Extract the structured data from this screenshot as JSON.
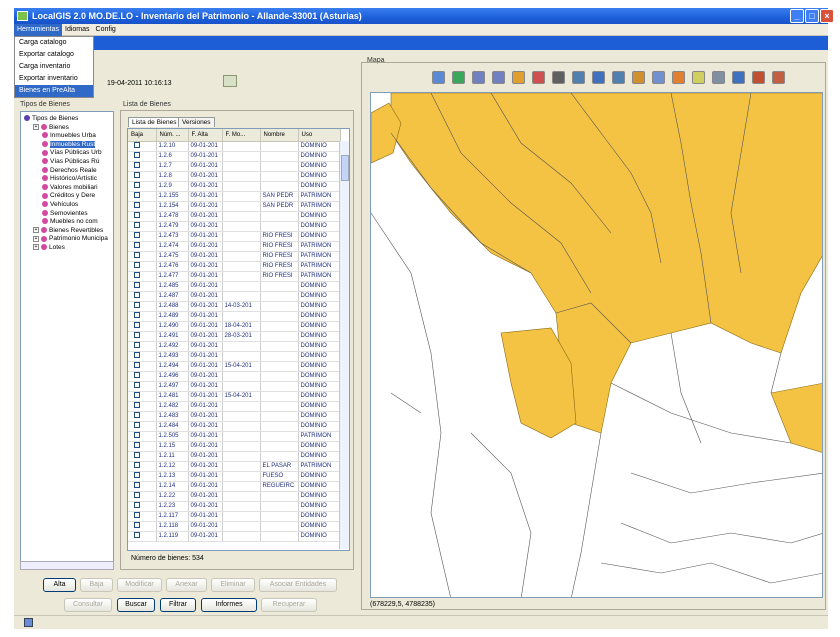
{
  "window": {
    "title": "LocalGIS 2.0 MO.DE.LO - Inventario del Patrimonio - Allande-33001 (Asturias)"
  },
  "menu": {
    "items": [
      "Herramientas",
      "Idiomas",
      "Config"
    ]
  },
  "dropdown": {
    "items": [
      "Carga catalogo",
      "Exportar catalogo",
      "Carga inventario",
      "Exportar inventario",
      "Bienes en PreAlta"
    ],
    "selected_index": 4
  },
  "header": {
    "datetime": "19-04-2011 10:16:13"
  },
  "tree": {
    "title": "Tipos de Bienes",
    "items": [
      {
        "label": "Tipos de Bienes",
        "level": 0,
        "kind": "root"
      },
      {
        "label": "Bienes",
        "level": 1,
        "kind": "group"
      },
      {
        "label": "Inmuebles Urba",
        "level": 2,
        "kind": "leaf"
      },
      {
        "label": "Inmuebles Rust",
        "level": 2,
        "kind": "leaf",
        "selected": true
      },
      {
        "label": "Vías Públicas Urb",
        "level": 2,
        "kind": "leaf"
      },
      {
        "label": "Vías Públicas Rú",
        "level": 2,
        "kind": "leaf"
      },
      {
        "label": "Derechos Reale",
        "level": 2,
        "kind": "leaf"
      },
      {
        "label": "Histórico/Artístic",
        "level": 2,
        "kind": "leaf"
      },
      {
        "label": "Valores mobiliari",
        "level": 2,
        "kind": "leaf"
      },
      {
        "label": "Créditos y Dere",
        "level": 2,
        "kind": "leaf"
      },
      {
        "label": "Vehículos",
        "level": 2,
        "kind": "leaf"
      },
      {
        "label": "Semovientes",
        "level": 2,
        "kind": "leaf"
      },
      {
        "label": "Muebles no com",
        "level": 2,
        "kind": "leaf"
      },
      {
        "label": "Bienes Revertibles",
        "level": 1,
        "kind": "group"
      },
      {
        "label": "Patrimonio Municipa",
        "level": 1,
        "kind": "group"
      },
      {
        "label": "Lotes",
        "level": 1,
        "kind": "group"
      }
    ]
  },
  "list": {
    "title": "Lista de Bienes",
    "tabs": [
      "Lista de Bienes",
      "Versiones"
    ],
    "columns": [
      "Baja",
      "Núm. ...",
      "F. Alta",
      "F. Mo...",
      "Nombre",
      "Uso"
    ],
    "rows": [
      [
        "1.2.10",
        "09-01-201",
        "",
        "",
        "DOMINIO"
      ],
      [
        "1.2.6",
        "09-01-201",
        "",
        "",
        "DOMINIO"
      ],
      [
        "1.2.7",
        "09-01-201",
        "",
        "",
        "DOMINIO"
      ],
      [
        "1.2.8",
        "09-01-201",
        "",
        "",
        "DOMINIO"
      ],
      [
        "1.2.9",
        "09-01-201",
        "",
        "",
        "DOMINIO"
      ],
      [
        "1.2.155",
        "09-01-201",
        "",
        "SAN PEDR",
        "PATRIMON"
      ],
      [
        "1.2.154",
        "09-01-201",
        "",
        "SAN PEDR",
        "PATRIMON"
      ],
      [
        "1.2.478",
        "09-01-201",
        "",
        "",
        "DOMINIO"
      ],
      [
        "1.2.479",
        "09-01-201",
        "",
        "",
        "DOMINIO"
      ],
      [
        "1.2.473",
        "09-01-201",
        "",
        "RIO FRESI",
        "DOMINIO"
      ],
      [
        "1.2.474",
        "09-01-201",
        "",
        "RIO FRESI",
        "PATRIMON"
      ],
      [
        "1.2.475",
        "09-01-201",
        "",
        "RIO FRESI",
        "PATRIMON"
      ],
      [
        "1.2.476",
        "09-01-201",
        "",
        "RIO FRESI",
        "PATRIMON"
      ],
      [
        "1.2.477",
        "09-01-201",
        "",
        "RIO FRESI",
        "PATRIMON"
      ],
      [
        "1.2.485",
        "09-01-201",
        "",
        "",
        "DOMINIO"
      ],
      [
        "1.2.487",
        "09-01-201",
        "",
        "",
        "DOMINIO"
      ],
      [
        "1.2.488",
        "09-01-201",
        "14-03-201",
        "",
        "DOMINIO"
      ],
      [
        "1.2.489",
        "09-01-201",
        "",
        "",
        "DOMINIO"
      ],
      [
        "1.2.490",
        "09-01-201",
        "18-04-201",
        "",
        "DOMINIO"
      ],
      [
        "1.2.491",
        "09-01-201",
        "28-03-201",
        "",
        "DOMINIO"
      ],
      [
        "1.2.492",
        "09-01-201",
        "",
        "",
        "DOMINIO"
      ],
      [
        "1.2.493",
        "09-01-201",
        "",
        "",
        "DOMINIO"
      ],
      [
        "1.2.494",
        "09-01-201",
        "15-04-201",
        "",
        "DOMINIO"
      ],
      [
        "1.2.496",
        "09-01-201",
        "",
        "",
        "DOMINIO"
      ],
      [
        "1.2.497",
        "09-01-201",
        "",
        "",
        "DOMINIO"
      ],
      [
        "1.2.481",
        "09-01-201",
        "15-04-201",
        "",
        "DOMINIO"
      ],
      [
        "1.2.482",
        "09-01-201",
        "",
        "",
        "DOMINIO"
      ],
      [
        "1.2.483",
        "09-01-201",
        "",
        "",
        "DOMINIO"
      ],
      [
        "1.2.484",
        "09-01-201",
        "",
        "",
        "DOMINIO"
      ],
      [
        "1.2.505",
        "09-01-201",
        "",
        "",
        "PATRIMON"
      ],
      [
        "1.2.15",
        "09-01-201",
        "",
        "",
        "DOMINIO"
      ],
      [
        "1.2.11",
        "09-01-201",
        "",
        "",
        "DOMINIO"
      ],
      [
        "1.2.12",
        "09-01-201",
        "",
        "EL PASAR",
        "PATRIMON"
      ],
      [
        "1.2.13",
        "09-01-201",
        "",
        "FUESO",
        "DOMINIO"
      ],
      [
        "1.2.14",
        "09-01-201",
        "",
        "REGUEIRC",
        "DOMINIO"
      ],
      [
        "1.2.22",
        "09-01-201",
        "",
        "",
        "DOMINIO"
      ],
      [
        "1.2.23",
        "09-01-201",
        "",
        "",
        "DOMINIO"
      ],
      [
        "1.2.117",
        "09-01-201",
        "",
        "",
        "DOMINIO"
      ],
      [
        "1.2.118",
        "09-01-201",
        "",
        "",
        "DOMINIO"
      ],
      [
        "1.2.119",
        "09-01-201",
        "",
        "",
        "DOMINIO"
      ]
    ],
    "count_label": "Número de bienes: 534"
  },
  "buttons": {
    "row1": [
      "Alta",
      "Baja",
      "Modificar",
      "Anexar",
      "Eliminar",
      "Asociar Entidades"
    ],
    "row2": [
      "Consultar",
      "Buscar",
      "Filtrar",
      "Informes",
      "Recuperar"
    ]
  },
  "map": {
    "title": "Mapa",
    "coords": "(678229,5, 4788235)",
    "fill_color": "#f5c344",
    "tool_icons": [
      "edit-icon",
      "globe-icon",
      "undo-icon",
      "redo-icon",
      "layers-icon",
      "house-icon",
      "grid-icon",
      "measure-icon",
      "print-icon",
      "table-icon",
      "building-icon",
      "select-icon",
      "zoom-icon",
      "pan-icon",
      "identify-icon",
      "arrow-icon",
      "book-icon",
      "copy-icon"
    ]
  }
}
